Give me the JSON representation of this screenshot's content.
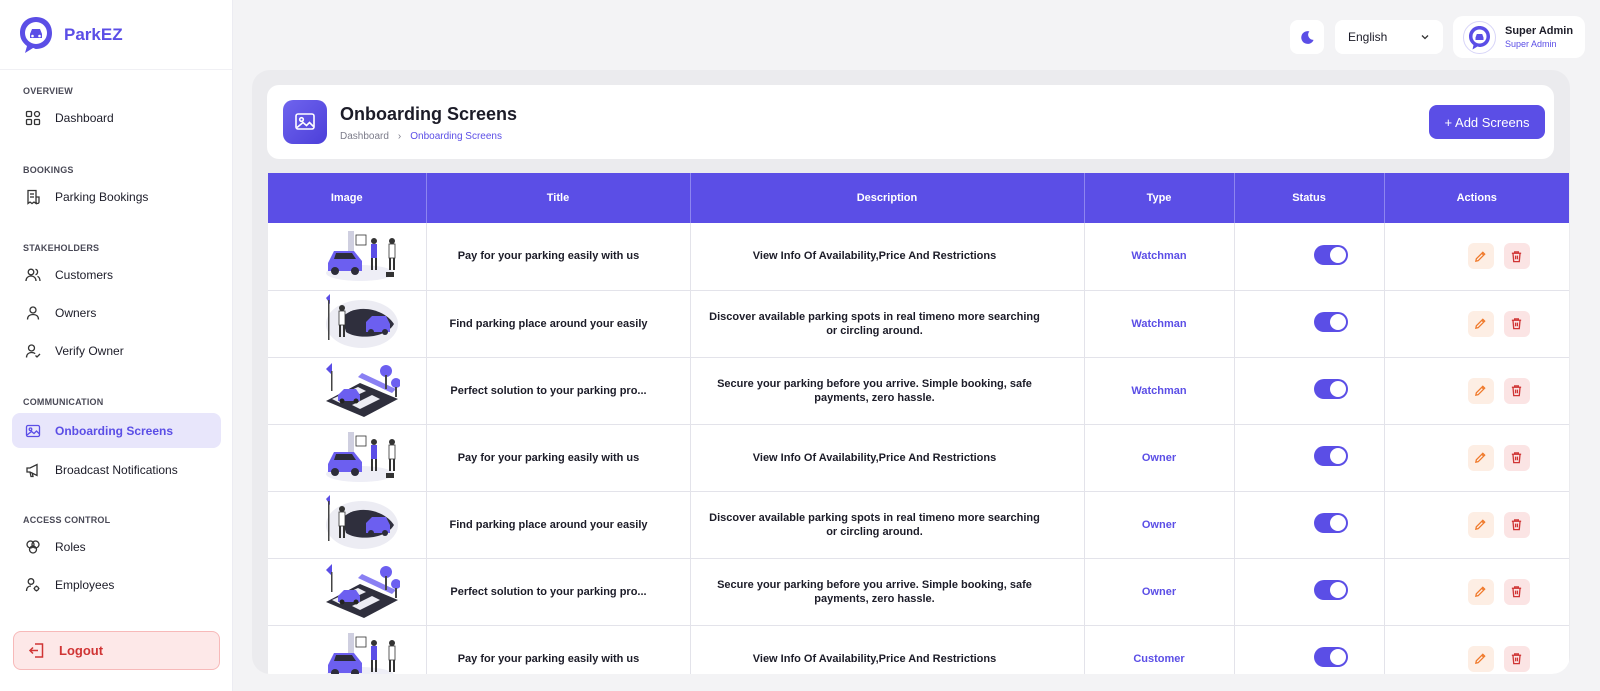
{
  "brand": {
    "name": "ParkEZ"
  },
  "sidebar": {
    "sections": [
      {
        "label": "OVERVIEW",
        "items": [
          {
            "label": "Dashboard",
            "icon": "grid-icon"
          }
        ]
      },
      {
        "label": "BOOKINGS",
        "items": [
          {
            "label": "Parking Bookings",
            "icon": "receipt-icon"
          }
        ]
      },
      {
        "label": "STAKEHOLDERS",
        "items": [
          {
            "label": "Customers",
            "icon": "users-icon"
          },
          {
            "label": "Owners",
            "icon": "user-icon"
          },
          {
            "label": "Verify Owner",
            "icon": "user-check-icon"
          }
        ]
      },
      {
        "label": "COMMUNICATION",
        "items": [
          {
            "label": "Onboarding Screens",
            "icon": "image-icon",
            "active": true
          },
          {
            "label": "Broadcast Notifications",
            "icon": "megaphone-icon"
          }
        ]
      },
      {
        "label": "ACCESS CONTROL",
        "items": [
          {
            "label": "Roles",
            "icon": "roles-icon"
          },
          {
            "label": "Employees",
            "icon": "employees-icon"
          }
        ]
      }
    ],
    "logout_label": "Logout"
  },
  "topbar": {
    "language": "English",
    "user_name": "Super Admin",
    "user_role": "Super Admin"
  },
  "page": {
    "title": "Onboarding Screens",
    "breadcrumb": [
      "Dashboard",
      "Onboarding Screens"
    ],
    "add_button": "+ Add Screens"
  },
  "table": {
    "columns": [
      "Image",
      "Title",
      "Description",
      "Type",
      "Status",
      "Actions"
    ],
    "rows": [
      {
        "image": "illustration-1",
        "title": "Pay for your parking easily with us",
        "description": "View Info Of Availability,Price  And Restrictions",
        "type": "Watchman",
        "status": true
      },
      {
        "image": "illustration-2",
        "title": "Find parking place around your easily",
        "description": "Discover available parking spots in real timeno more searching or circling around.",
        "type": "Watchman",
        "status": true
      },
      {
        "image": "illustration-3",
        "title": "Perfect solution to your parking pro...",
        "description": "Secure your parking before you arrive. Simple booking, safe payments, zero hassle.",
        "type": "Watchman",
        "status": true
      },
      {
        "image": "illustration-1",
        "title": "Pay for your parking easily with us",
        "description": "View Info Of Availability,Price  And Restrictions",
        "type": "Owner",
        "status": true
      },
      {
        "image": "illustration-2",
        "title": "Find parking place around your easily",
        "description": "Discover available parking spots in real timeno more searching or circling around.",
        "type": "Owner",
        "status": true
      },
      {
        "image": "illustration-3",
        "title": "Perfect solution to your parking pro...",
        "description": "Secure your parking before you arrive. Simple booking, safe payments, zero hassle.",
        "type": "Owner",
        "status": true
      },
      {
        "image": "illustration-1",
        "title": "Pay for your parking easily with us",
        "description": "View Info Of Availability,Price  And Restrictions",
        "type": "Customer",
        "status": true
      }
    ]
  },
  "colors": {
    "accent": "#5b4ee6",
    "danger": "#d03434",
    "edit": "#f07a2c"
  }
}
